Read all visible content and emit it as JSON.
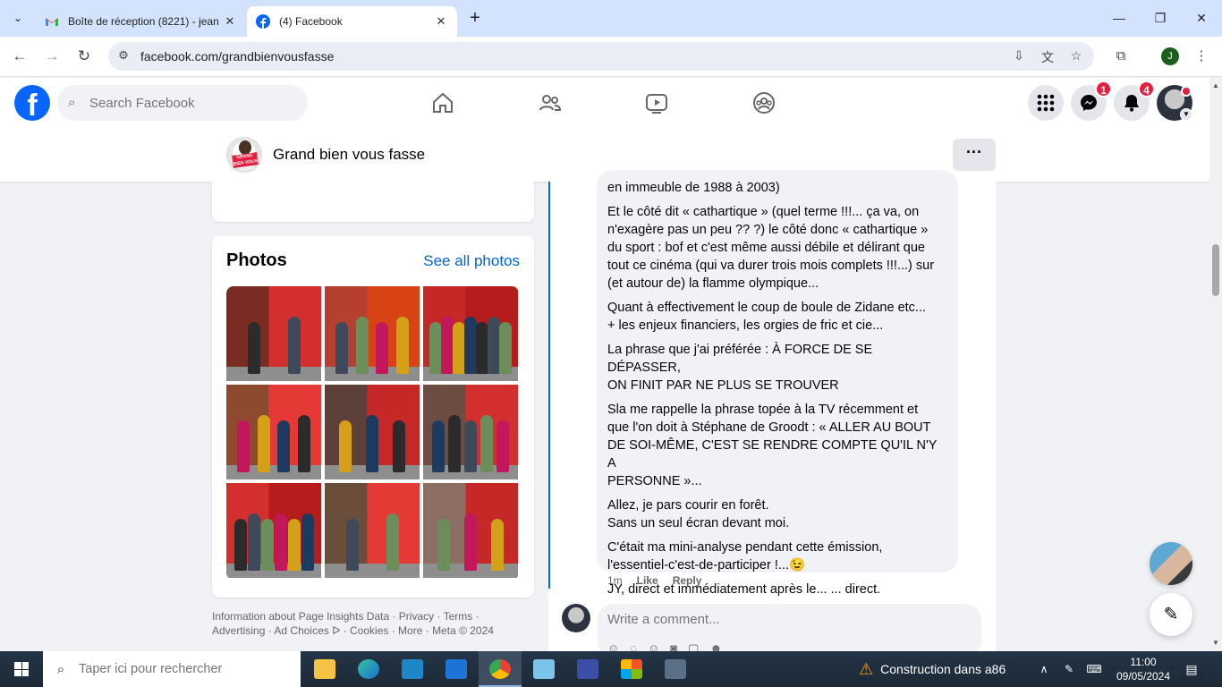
{
  "browser": {
    "tabs": [
      {
        "title": "Boîte de réception (8221) - jean",
        "icon": "gmail-icon"
      },
      {
        "title": "(4) Facebook",
        "icon": "facebook-icon"
      }
    ],
    "url": "facebook.com/grandbienvousfasse"
  },
  "fb_header": {
    "search_placeholder": "Search Facebook",
    "messenger_badge": "1",
    "notifications_badge": "4"
  },
  "page": {
    "name": "Grand bien vous fasse",
    "avatar_text": "GRAND BIEN VOUS FASSE",
    "more_label": "···"
  },
  "photos": {
    "title": "Photos",
    "see_all": "See all photos",
    "count": 9
  },
  "footer": {
    "links": [
      "Information about Page Insights Data",
      "Privacy",
      "Terms",
      "Advertising",
      "Ad Choices",
      "Cookies",
      "More",
      "Meta © 2024"
    ]
  },
  "comment": {
    "paragraphs": [
      "en immeuble de 1988 à 2003)",
      "Et le côté dit « cathartique » (quel terme !!!... ça va, on\nn'exagère pas un peu ?? ?) le côté donc « cathartique »\ndu sport : bof et c'est même aussi débile et délirant que\ntout ce cinéma (qui va durer trois mois complets !!!...) sur\n(et autour de) la flamme olympique...",
      "Quant à effectivement le coup de boule de Zidane etc...\n+ les enjeux financiers, les orgies de fric et cie...",
      "La phrase que j'ai préférée : À FORCE DE SE DÉPASSER,\nON FINIT PAR NE PLUS SE TROUVER",
      "Sla me rappelle la phrase topée à la TV récemment et\nque l'on doit à Stéphane de Groodt : « ALLER AU BOUT\nDE SOI-MÊME, C'EST SE RENDRE COMPTE QU'IL N'Y A\nPERSONNE »...",
      "Allez, je pars courir en forêt.\nSans un seul écran devant moi.",
      "C'était ma mini-analyse pendant cette émission,\nl'essentiel-c'est-de-participer !...😉",
      "JY, direct et immédiatement après le... ... direct."
    ],
    "time": "1m",
    "like": "Like",
    "reply": "Reply"
  },
  "write_comment": {
    "placeholder": "Write a comment..."
  },
  "taskbar": {
    "search_placeholder": "Taper ici pour rechercher",
    "weather": "Construction dans a86",
    "time": "11:00",
    "date": "09/05/2024"
  },
  "colors": {
    "fb_blue": "#0866ff",
    "link_blue": "#0064d1",
    "badge_red": "#e41e3f"
  }
}
